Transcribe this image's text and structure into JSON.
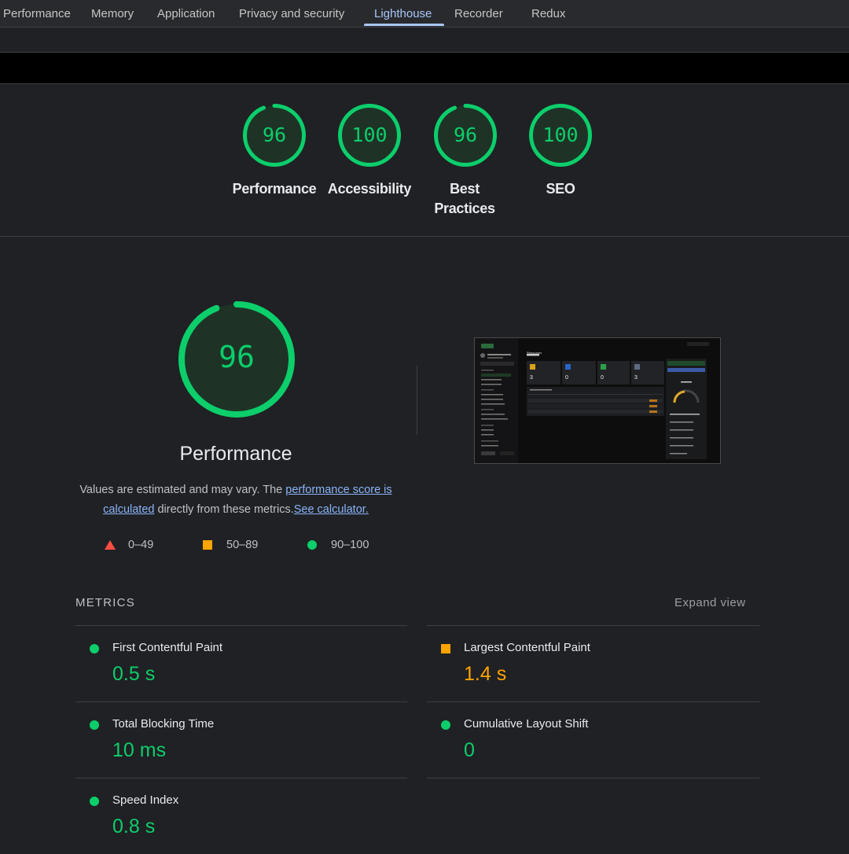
{
  "tabs": [
    {
      "label": "Performance"
    },
    {
      "label": "Memory"
    },
    {
      "label": "Application"
    },
    {
      "label": "Privacy and security"
    },
    {
      "label": "Lighthouse"
    },
    {
      "label": "Recorder"
    },
    {
      "label": "Redux"
    }
  ],
  "active_tab": "Lighthouse",
  "categories": [
    {
      "score": "96",
      "label": "Performance",
      "level": 0.96
    },
    {
      "score": "100",
      "label": "Accessibility",
      "level": 1.0
    },
    {
      "score": "96",
      "label": "Best Practices",
      "level": 0.96
    },
    {
      "score": "100",
      "label": "SEO",
      "level": 1.0
    }
  ],
  "performance": {
    "score": "96",
    "level": 0.96,
    "title": "Performance",
    "desc_prefix": "Values are estimated and may vary. The ",
    "desc_link1": "performance score is calculated",
    "desc_middle": " directly from these metrics.",
    "desc_link2": "See calculator."
  },
  "legend": [
    {
      "range": "0–49",
      "shape": "triangle",
      "color": "#ff4e42"
    },
    {
      "range": "50–89",
      "shape": "square",
      "color": "#ffa400"
    },
    {
      "range": "90–100",
      "shape": "circle",
      "color": "#0cce6b"
    }
  ],
  "metrics_section": {
    "title": "METRICS",
    "expand_label": "Expand view"
  },
  "metrics": [
    {
      "name": "First Contentful Paint",
      "value": "0.5 s",
      "rating": "good"
    },
    {
      "name": "Largest Contentful Paint",
      "value": "1.4 s",
      "rating": "average"
    },
    {
      "name": "Total Blocking Time",
      "value": "10 ms",
      "rating": "good"
    },
    {
      "name": "Cumulative Layout Shift",
      "value": "0",
      "rating": "good"
    },
    {
      "name": "Speed Index",
      "value": "0.8 s",
      "rating": "good"
    }
  ],
  "colors": {
    "good": "#0cce6b",
    "average": "#ffa400",
    "poor": "#ff4e42",
    "link": "#8ab4f8",
    "active_tab": "#a8c7fa"
  },
  "screenshot": {
    "page_heading": "Resources",
    "stat_values": [
      "3",
      "0",
      "0",
      "3"
    ]
  }
}
